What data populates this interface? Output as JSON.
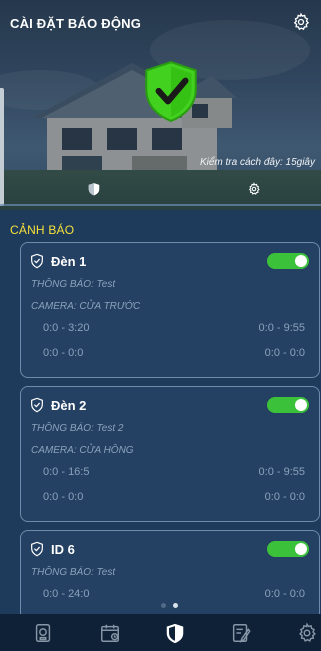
{
  "header": {
    "title": "CÀI ĐẶT BÁO ĐỘNG",
    "last_check": "Kiểm tra cách đây: 15giây"
  },
  "section": {
    "title": "CẢNH BÁO"
  },
  "alerts": [
    {
      "name": "Đèn 1",
      "notify": "THÔNG BÁO: Test",
      "camera": "CAMERA: CỬA TRƯỚC",
      "times": [
        [
          "0:0 - 3:20",
          "0:0 - 9:55"
        ],
        [
          "0:0 - 0:0",
          "0:0 - 0:0"
        ]
      ],
      "enabled": true
    },
    {
      "name": "Đèn 2",
      "notify": "THÔNG BÁO: Test 2",
      "camera": "CAMERA: CỬA HÔNG",
      "times": [
        [
          "0:0 - 16:5",
          "0:0 - 9:55"
        ],
        [
          "0:0 - 0:0",
          "0:0 - 0:0"
        ]
      ],
      "enabled": true
    },
    {
      "name": "ID 6",
      "notify": "THÔNG BÁO: Test",
      "times": [
        [
          "0:0 - 24:0",
          "0:0 - 0:0"
        ]
      ],
      "enabled": true
    }
  ],
  "colors": {
    "accent": "#3cc23a",
    "section": "#f5e03a",
    "nav_bg": "#0f2136"
  },
  "nav": {
    "items": [
      "camera-icon",
      "schedule-icon",
      "shield-icon",
      "notes-icon",
      "gear-icon"
    ],
    "active": 2
  },
  "pager": {
    "count": 2,
    "active": 1
  }
}
